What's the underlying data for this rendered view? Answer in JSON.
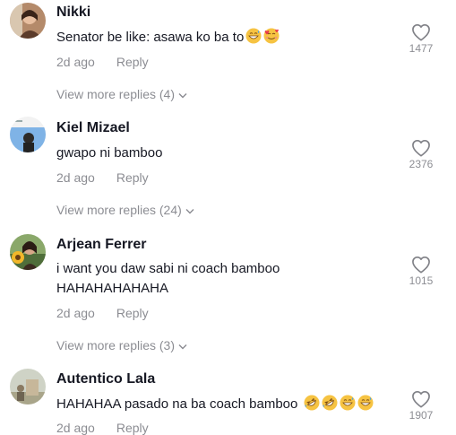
{
  "comments": [
    {
      "username": "Nikki",
      "text": "Senator be like: asawa ko ba to",
      "emojis": [
        "grinning-sweat-emoji",
        "smiling-hearts-emoji"
      ],
      "time": "2d ago",
      "reply_label": "Reply",
      "likes": "1477",
      "view_more": "View more replies (4)"
    },
    {
      "username": "Kiel Mizael",
      "text": "gwapo ni bamboo",
      "time": "2d ago",
      "reply_label": "Reply",
      "likes": "2376",
      "view_more": "View more replies (24)"
    },
    {
      "username": "Arjean Ferrer",
      "text_line1": "i want you daw sabi ni coach bamboo",
      "text_line2": "HAHAHAHAHAHA",
      "time": "2d ago",
      "reply_label": "Reply",
      "likes": "1015",
      "view_more": "View more replies (3)"
    },
    {
      "username": "Autentico Lala",
      "text": "HAHAHAA pasado na ba coach bamboo",
      "emojis": [
        "rofl-emoji",
        "rofl-emoji",
        "grinning-sweat-emoji",
        "grinning-sweat-emoji"
      ],
      "time": "2d ago",
      "reply_label": "Reply",
      "likes": "1907"
    }
  ],
  "colors": {
    "text": "#161823",
    "secondary": "rgba(22,24,35,0.5)",
    "emoji_yellow": "#f6c342",
    "emoji_blue": "#4fa3e3"
  }
}
